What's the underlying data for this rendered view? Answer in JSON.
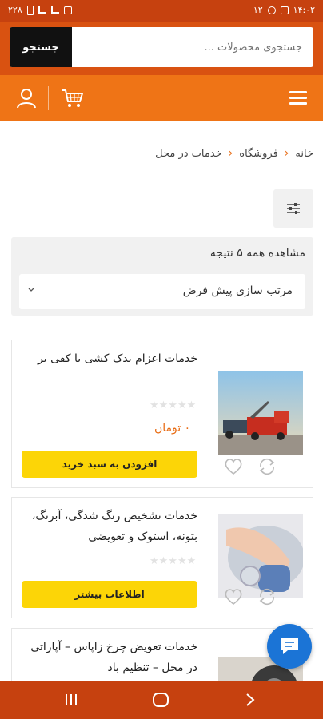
{
  "status_bar": {
    "time": "۱۴:۰۲",
    "left_text": "۲۲۸",
    "right_extra": "۱۲"
  },
  "search": {
    "placeholder": "جستجوی محصولات ...",
    "button_label": "جستجو"
  },
  "breadcrumb": {
    "items": [
      "خانه",
      "فروشگاه",
      "خدمات در محل"
    ]
  },
  "results": {
    "count_text": "مشاهده همه ۵ نتیجه",
    "sort_selected": "مرتب سازی پیش فرض"
  },
  "products": [
    {
      "title": "خدمات اعزام یدک کشی یا کفی بر",
      "price": "۰ تومان",
      "button": "افزودن به سبد خرید",
      "rating_stars": "★★★★★"
    },
    {
      "title": "خدمات تشخیص رنگ شدگی، آبرنگ، بتونه، استوک و تعویضی",
      "button": "اطلاعات بیشتر",
      "rating_stars": "★★★★★"
    },
    {
      "title": "خدمات تعویض چرخ زاپاس – آپاراتی در محل – تنظیم باد"
    }
  ],
  "icons": {
    "menu": "hamburger-icon",
    "cart": "cart-icon",
    "user": "user-icon",
    "filter": "filter-icon",
    "sort": "chevron-down-icon",
    "wishlist": "heart-icon",
    "compare": "swap-icon",
    "chat": "chat-icon"
  },
  "colors": {
    "status_bar": "#c6410f",
    "header": "#d95211",
    "nav": "#ef7416",
    "accent": "#e86b12",
    "cta": "#fcd507",
    "fab": "#1b74d6"
  }
}
